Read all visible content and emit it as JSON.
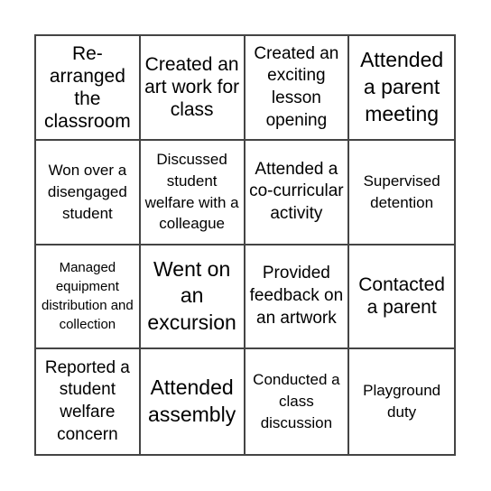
{
  "board": {
    "cells": [
      {
        "text": "Re-arranged the classroom",
        "size": "fs-l"
      },
      {
        "text": "Created an art work for class",
        "size": "fs-l"
      },
      {
        "text": "Created an exciting lesson opening",
        "size": "fs-m"
      },
      {
        "text": "Attended a parent meeting",
        "size": "fs-xl"
      },
      {
        "text": "Won over a disengaged student",
        "size": "fs-s"
      },
      {
        "text": "Discussed student welfare with a colleague",
        "size": "fs-s"
      },
      {
        "text": "Attended a co-curricular activity",
        "size": "fs-m"
      },
      {
        "text": "Supervised detention",
        "size": "fs-s"
      },
      {
        "text": "Managed equipment distribution and collection",
        "size": "fs-xs"
      },
      {
        "text": "Went on an excursion",
        "size": "fs-xl"
      },
      {
        "text": "Provided feedback on an artwork",
        "size": "fs-m"
      },
      {
        "text": "Contacted a parent",
        "size": "fs-l"
      },
      {
        "text": "Reported a student welfare concern",
        "size": "fs-m"
      },
      {
        "text": "Attended assembly",
        "size": "fs-xl"
      },
      {
        "text": "Conducted a class discussion",
        "size": "fs-s"
      },
      {
        "text": "Playground duty",
        "size": "fs-s"
      }
    ]
  }
}
